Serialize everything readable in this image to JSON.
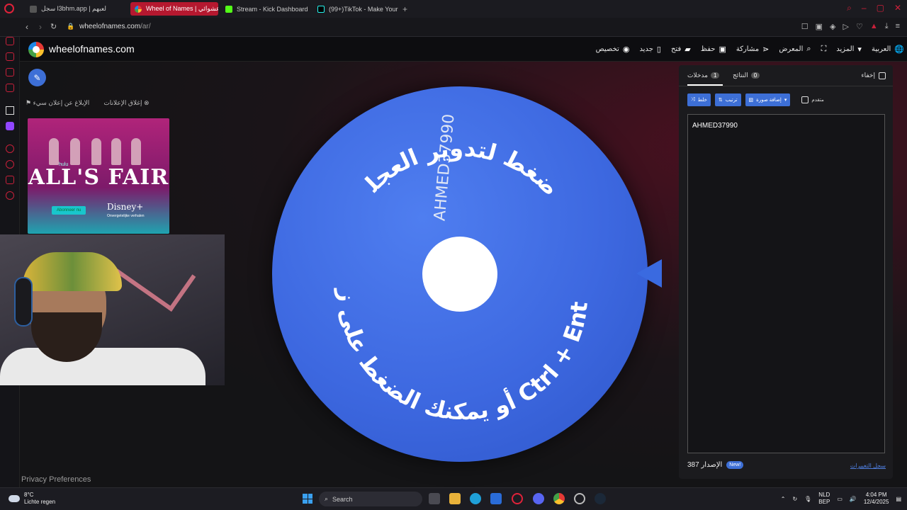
{
  "browser": {
    "tabs": [
      {
        "label": "سجل l3bhm.app | لعبهم",
        "active": false
      },
      {
        "label": "Wheel of Names | عشوائي",
        "active": true
      },
      {
        "label": "Stream - Kick Dashboard",
        "active": false
      },
      {
        "label": "(99+)TikTok - Make Your",
        "active": false
      }
    ],
    "new_tab": "+",
    "url_host": "wheelofnames.com",
    "url_path": "/ar/"
  },
  "site": {
    "name": "wheelofnames.com",
    "menu": [
      {
        "label": "العربية",
        "icon": "globe-icon"
      },
      {
        "label": "المزيد",
        "icon": "chevron-down-icon"
      },
      {
        "label": "",
        "icon": "fullscreen-icon"
      },
      {
        "label": "المعرض",
        "icon": "search-icon"
      },
      {
        "label": "مشاركة",
        "icon": "share-icon"
      },
      {
        "label": "حفظ",
        "icon": "save-icon"
      },
      {
        "label": "فتح",
        "icon": "folder-icon"
      },
      {
        "label": "جديد",
        "icon": "file-icon"
      },
      {
        "label": "تخصيص",
        "icon": "palette-icon"
      }
    ]
  },
  "ads": {
    "close_ads": "إغلاق الإعلانات",
    "report_ad": "الإبلاغ عن إعلان سيء",
    "ad_title": "ALL'S FAIR",
    "ad_brand": "hulu",
    "ad_button": "Abonneer nu",
    "ad_disney": "Disney+",
    "ad_sub": "Onvergetelijke verhalen"
  },
  "wheel": {
    "entry_label": "AHMED37990",
    "instruction_top": "اضغط لتدوير العجلة",
    "instruction_bottom": "أو يمكنك الضغط على زر Ctrl + Enter",
    "color": "#3d68e0"
  },
  "panel": {
    "tab_entries": "مدخلات",
    "tab_entries_count": "1",
    "tab_results": "النتائج",
    "tab_results_count": "0",
    "hide_label": "إخفاء",
    "shuffle": "خلط",
    "sort": "ترتيب",
    "add_image": "إضافة صورة",
    "advanced": "متقدم",
    "entries_text": "AHMED37990",
    "version_label": "الإصدار 387",
    "new_badge": "New!",
    "changelog": "سجل التغييرات"
  },
  "footer": {
    "privacy": "Privacy Preferences"
  },
  "taskbar": {
    "temp": "8°C",
    "weather": "Lichte regen",
    "search": "Search",
    "lang1": "NLD",
    "lang2": "BEP",
    "time": "4:04 PM",
    "date": "12/4/2025"
  }
}
